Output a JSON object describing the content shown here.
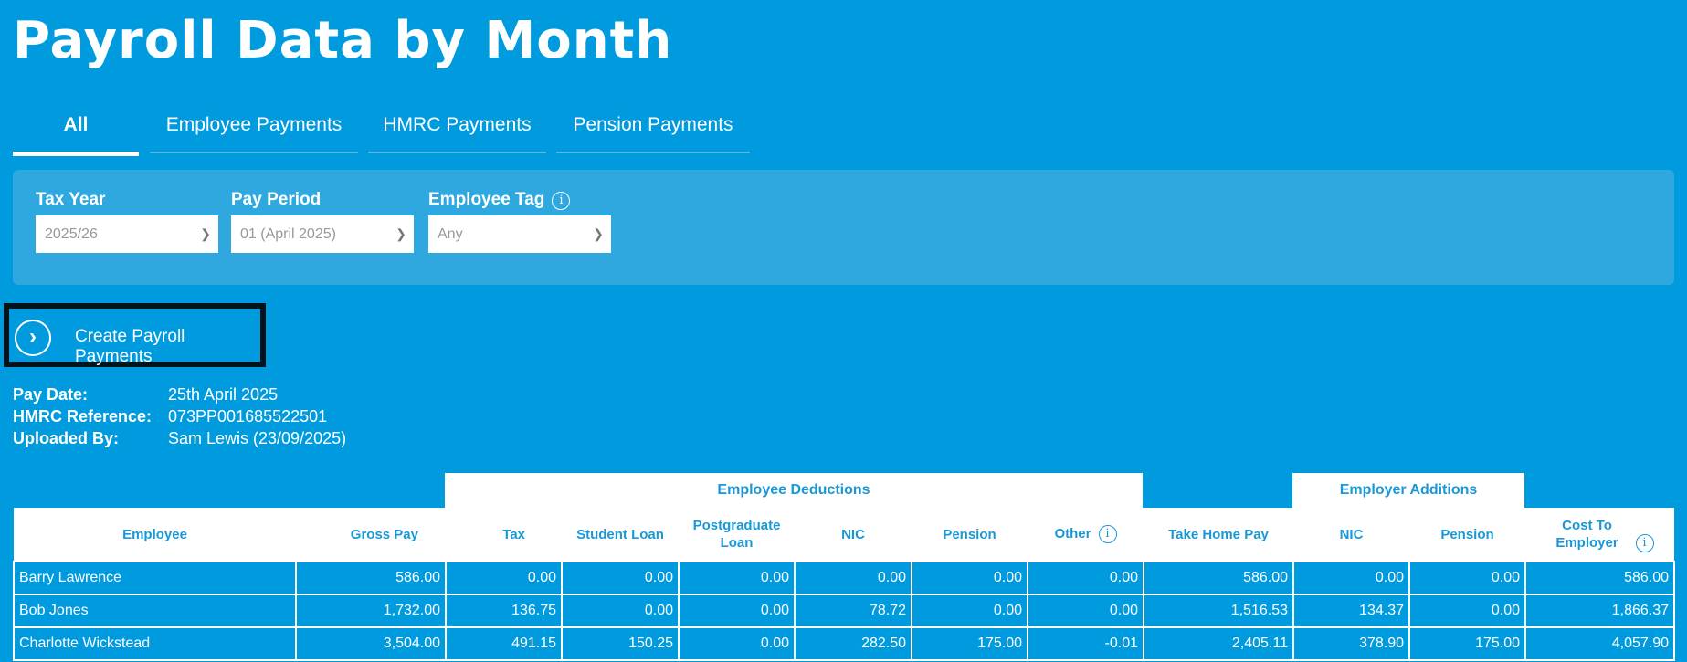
{
  "title": "Payroll Data by Month",
  "tabs": [
    "All",
    "Employee Payments",
    "HMRC Payments",
    "Pension Payments"
  ],
  "filters": {
    "tax_year": {
      "label": "Tax Year",
      "value": "2025/26"
    },
    "pay_period": {
      "label": "Pay Period",
      "value": "01 (April 2025)"
    },
    "employee_tag": {
      "label": "Employee Tag",
      "value": "Any"
    }
  },
  "create_button": "Create Payroll Payments",
  "info": {
    "pay_date_label": "Pay Date:",
    "pay_date": "25th April 2025",
    "hmrc_ref_label": "HMRC Reference:",
    "hmrc_ref": "073PP001685522501",
    "uploaded_label": "Uploaded By:",
    "uploaded": "Sam Lewis (23/09/2025)"
  },
  "table": {
    "groups": {
      "deductions": "Employee Deductions",
      "additions": "Employer Additions"
    },
    "columns": [
      "Employee",
      "Gross Pay",
      "Tax",
      "Student Loan",
      "Postgraduate Loan",
      "NIC",
      "Pension",
      "Other",
      "Take Home Pay",
      "NIC",
      "Pension",
      "Cost To Employer"
    ],
    "rows": [
      [
        "Barry Lawrence",
        "586.00",
        "0.00",
        "0.00",
        "0.00",
        "0.00",
        "0.00",
        "0.00",
        "586.00",
        "0.00",
        "0.00",
        "586.00"
      ],
      [
        "Bob Jones",
        "1,732.00",
        "136.75",
        "0.00",
        "0.00",
        "78.72",
        "0.00",
        "0.00",
        "1,516.53",
        "134.37",
        "0.00",
        "1,866.37"
      ],
      [
        "Charlotte Wickstead",
        "3,504.00",
        "491.15",
        "150.25",
        "0.00",
        "282.50",
        "175.00",
        "-0.01",
        "2,405.11",
        "378.90",
        "175.00",
        "4,057.90"
      ]
    ]
  }
}
